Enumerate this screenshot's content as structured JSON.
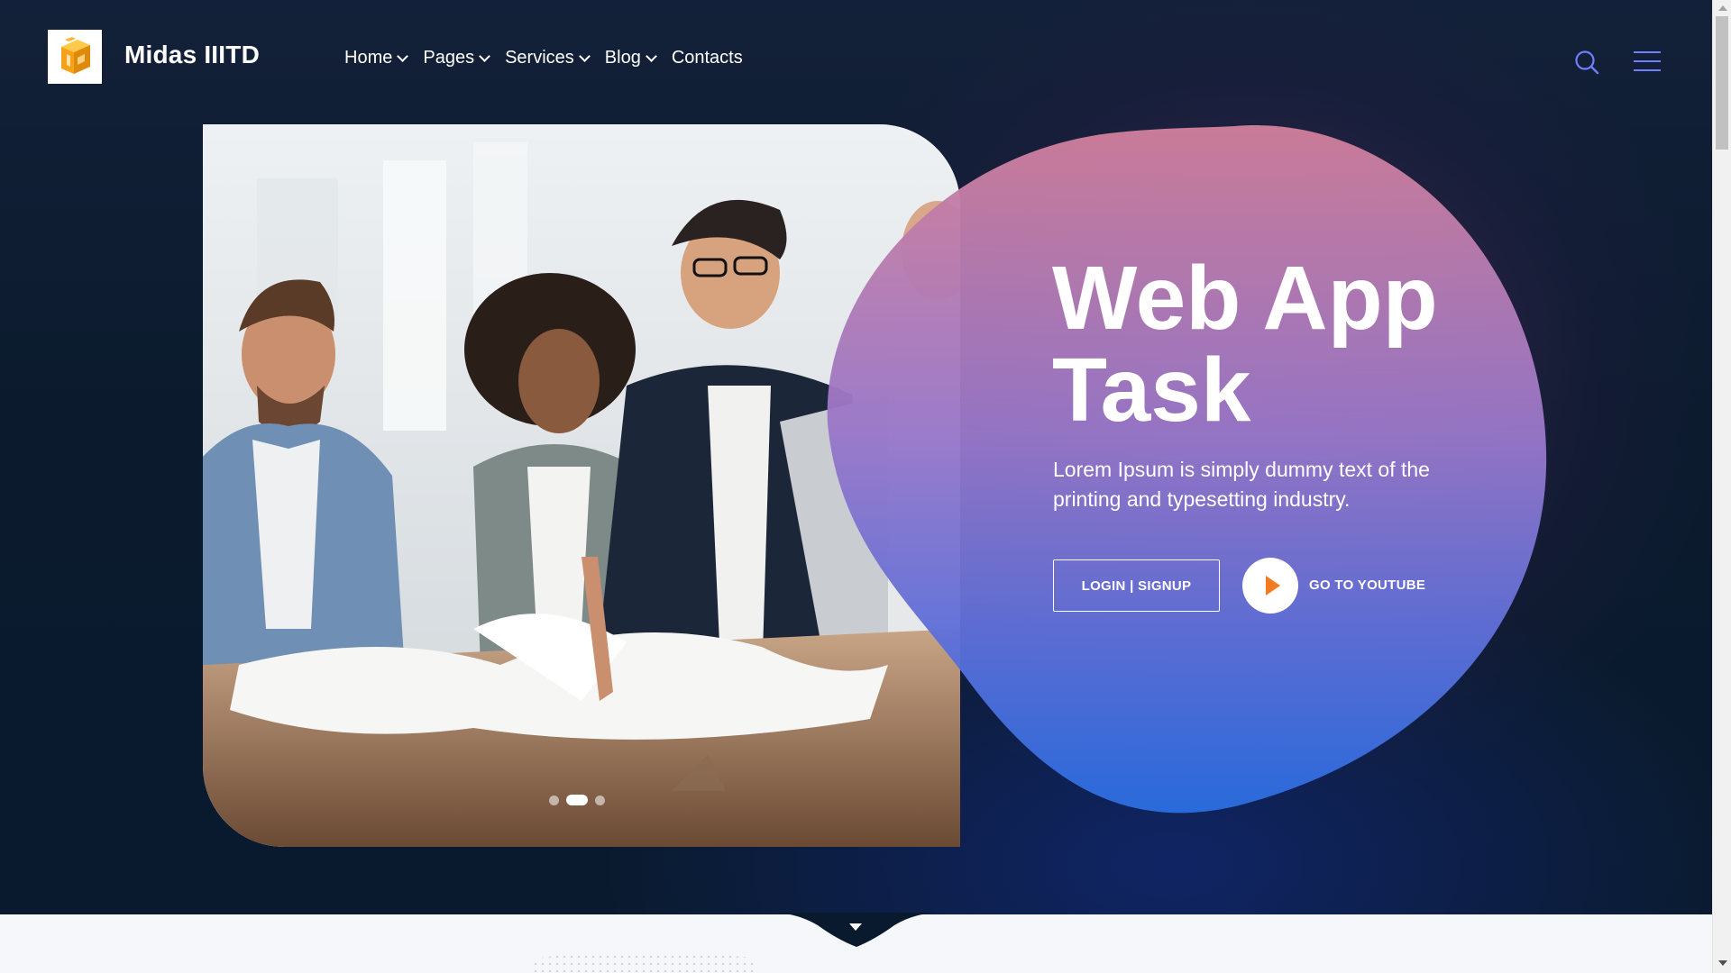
{
  "header": {
    "brand": "Midas IIITD",
    "logo_icon": "cube-logo-icon",
    "nav": [
      {
        "label": "Home",
        "has_dropdown": true
      },
      {
        "label": "Pages",
        "has_dropdown": true
      },
      {
        "label": "Services",
        "has_dropdown": true
      },
      {
        "label": "Blog",
        "has_dropdown": true
      },
      {
        "label": "Contacts",
        "has_dropdown": false
      }
    ],
    "search_icon": "search-icon",
    "menu_icon": "hamburger-menu-icon"
  },
  "hero": {
    "title_line1": "Web App",
    "title_line2": "Task",
    "subtitle": "Lorem Ipsum is simply dummy text of the printing and typesetting industry.",
    "primary_button": "LOGIN | SIGNUP",
    "secondary_button": "GO TO YOUTUBE",
    "carousel": {
      "slides": 3,
      "active_index": 1
    }
  },
  "colors": {
    "background_dark": "#0a1a2b",
    "blob_top": "#c97b9c",
    "blob_bottom": "#2a6fe0",
    "accent_play": "#f47b20",
    "logo_orange": "#f6a11a",
    "icon_accent": "#6f7fff"
  }
}
